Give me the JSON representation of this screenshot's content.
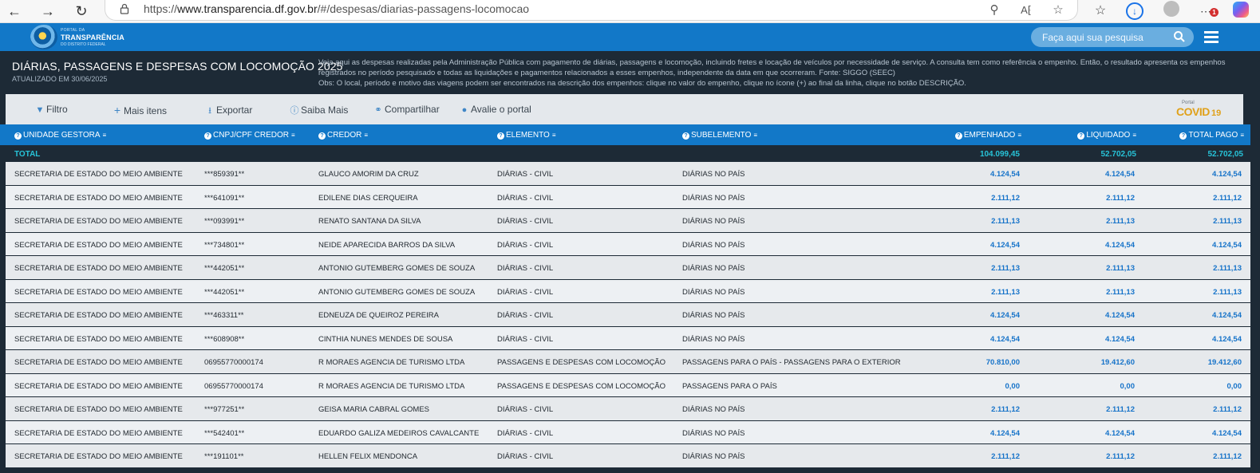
{
  "browser": {
    "url_prefix": "https://",
    "url_domain": "www.transparencia.df.gov.br",
    "url_path": "/#/despesas/diarias-passagens-locomocao",
    "notification_count": "1"
  },
  "site": {
    "logo_small": "PORTAL DA",
    "logo_big": "TRANSPARÊNCIA",
    "logo_sub": "DO DISTRITO FEDERAL",
    "search_placeholder": "Faça aqui sua pesquisa"
  },
  "page": {
    "title": "DIÁRIAS, PASSAGENS E DESPESAS COM LOCOMOÇÃO 2025",
    "updated": "ATUALIZADO EM 30/06/2025",
    "description_1": "Veja aqui as despesas realizadas pela Administração Pública com pagamento de diárias, passagens e locomoção, incluindo fretes e locação de veículos por necessidade de serviço. A consulta tem como referência o empenho. Então, o resultado apresenta os empenhos registrados no período pesquisado e todas as liquidações e pagamentos relacionados a esses empenhos, independente da data em que ocorreram. Fonte: SIGGO (SEEC)",
    "description_2": "Obs: O local, período e motivo das viagens podem ser encontrados na descrição dos empenhos: clique no valor do empenho, clique no ícone (+) ao final da linha, clique no botão DESCRIÇÃO."
  },
  "toolbar": {
    "filter": "Filtro",
    "more_items": "Mais itens",
    "export": "Exportar",
    "learn_more": "Saiba Mais",
    "share": "Compartilhar",
    "rate": "Avalie o portal",
    "covid_small": "Portal",
    "covid_big": "COVID",
    "covid_num": "19"
  },
  "table": {
    "headers": {
      "unidade": "UNIDADE GESTORA",
      "cnpj": "CNPJ/CPF CREDOR",
      "credor": "CREDOR",
      "elemento": "ELEMENTO",
      "subelemento": "SUBELEMENTO",
      "empenhado": "EMPENHADO",
      "liquidado": "LIQUIDADO",
      "pago": "TOTAL PAGO"
    },
    "total": {
      "label": "TOTAL",
      "empenhado": "104.099,45",
      "liquidado": "52.702,05",
      "pago": "52.702,05"
    },
    "rows": [
      {
        "unidade": "SECRETARIA DE ESTADO DO MEIO AMBIENTE",
        "cnpj": "***859391**",
        "credor": "GLAUCO AMORIM DA CRUZ",
        "elemento": "DIÁRIAS - CIVIL",
        "subelemento": "DIÁRIAS NO PAÍS",
        "empenhado": "4.124,54",
        "liquidado": "4.124,54",
        "pago": "4.124,54"
      },
      {
        "unidade": "SECRETARIA DE ESTADO DO MEIO AMBIENTE",
        "cnpj": "***641091**",
        "credor": "EDILENE DIAS CERQUEIRA",
        "elemento": "DIÁRIAS - CIVIL",
        "subelemento": "DIÁRIAS NO PAÍS",
        "empenhado": "2.111,12",
        "liquidado": "2.111,12",
        "pago": "2.111,12"
      },
      {
        "unidade": "SECRETARIA DE ESTADO DO MEIO AMBIENTE",
        "cnpj": "***093991**",
        "credor": "RENATO SANTANA DA SILVA",
        "elemento": "DIÁRIAS - CIVIL",
        "subelemento": "DIÁRIAS NO PAÍS",
        "empenhado": "2.111,13",
        "liquidado": "2.111,13",
        "pago": "2.111,13"
      },
      {
        "unidade": "SECRETARIA DE ESTADO DO MEIO AMBIENTE",
        "cnpj": "***734801**",
        "credor": "NEIDE APARECIDA BARROS DA SILVA",
        "elemento": "DIÁRIAS - CIVIL",
        "subelemento": "DIÁRIAS NO PAÍS",
        "empenhado": "4.124,54",
        "liquidado": "4.124,54",
        "pago": "4.124,54"
      },
      {
        "unidade": "SECRETARIA DE ESTADO DO MEIO AMBIENTE",
        "cnpj": "***442051**",
        "credor": "ANTONIO GUTEMBERG GOMES DE SOUZA",
        "elemento": "DIÁRIAS - CIVIL",
        "subelemento": "DIÁRIAS NO PAÍS",
        "empenhado": "2.111,13",
        "liquidado": "2.111,13",
        "pago": "2.111,13"
      },
      {
        "unidade": "SECRETARIA DE ESTADO DO MEIO AMBIENTE",
        "cnpj": "***442051**",
        "credor": "ANTONIO GUTEMBERG GOMES DE SOUZA",
        "elemento": "DIÁRIAS - CIVIL",
        "subelemento": "DIÁRIAS NO PAÍS",
        "empenhado": "2.111,13",
        "liquidado": "2.111,13",
        "pago": "2.111,13"
      },
      {
        "unidade": "SECRETARIA DE ESTADO DO MEIO AMBIENTE",
        "cnpj": "***463311**",
        "credor": "EDNEUZA DE QUEIROZ PEREIRA",
        "elemento": "DIÁRIAS - CIVIL",
        "subelemento": "DIÁRIAS NO PAÍS",
        "empenhado": "4.124,54",
        "liquidado": "4.124,54",
        "pago": "4.124,54"
      },
      {
        "unidade": "SECRETARIA DE ESTADO DO MEIO AMBIENTE",
        "cnpj": "***608908**",
        "credor": "CINTHIA NUNES MENDES DE SOUSA",
        "elemento": "DIÁRIAS - CIVIL",
        "subelemento": "DIÁRIAS NO PAÍS",
        "empenhado": "4.124,54",
        "liquidado": "4.124,54",
        "pago": "4.124,54"
      },
      {
        "unidade": "SECRETARIA DE ESTADO DO MEIO AMBIENTE",
        "cnpj": "06955770000174",
        "credor": "R MORAES AGENCIA DE TURISMO LTDA",
        "elemento": "PASSAGENS E DESPESAS COM LOCOMOÇÃO",
        "subelemento": "PASSAGENS PARA O PAÍS - PASSAGENS PARA O EXTERIOR",
        "empenhado": "70.810,00",
        "liquidado": "19.412,60",
        "pago": "19.412,60"
      },
      {
        "unidade": "SECRETARIA DE ESTADO DO MEIO AMBIENTE",
        "cnpj": "06955770000174",
        "credor": "R MORAES AGENCIA DE TURISMO LTDA",
        "elemento": "PASSAGENS E DESPESAS COM LOCOMOÇÃO",
        "subelemento": "PASSAGENS PARA O PAÍS",
        "empenhado": "0,00",
        "liquidado": "0,00",
        "pago": "0,00"
      },
      {
        "unidade": "SECRETARIA DE ESTADO DO MEIO AMBIENTE",
        "cnpj": "***977251**",
        "credor": "GEISA MARIA CABRAL GOMES",
        "elemento": "DIÁRIAS - CIVIL",
        "subelemento": "DIÁRIAS NO PAÍS",
        "empenhado": "2.111,12",
        "liquidado": "2.111,12",
        "pago": "2.111,12"
      },
      {
        "unidade": "SECRETARIA DE ESTADO DO MEIO AMBIENTE",
        "cnpj": "***542401**",
        "credor": "EDUARDO GALIZA MEDEIROS CAVALCANTE",
        "elemento": "DIÁRIAS - CIVIL",
        "subelemento": "DIÁRIAS NO PAÍS",
        "empenhado": "4.124,54",
        "liquidado": "4.124,54",
        "pago": "4.124,54"
      },
      {
        "unidade": "SECRETARIA DE ESTADO DO MEIO AMBIENTE",
        "cnpj": "***191101**",
        "credor": "HELLEN FELIX MENDONCA",
        "elemento": "DIÁRIAS - CIVIL",
        "subelemento": "DIÁRIAS NO PAÍS",
        "empenhado": "2.111,12",
        "liquidado": "2.111,12",
        "pago": "2.111,12"
      }
    ]
  }
}
